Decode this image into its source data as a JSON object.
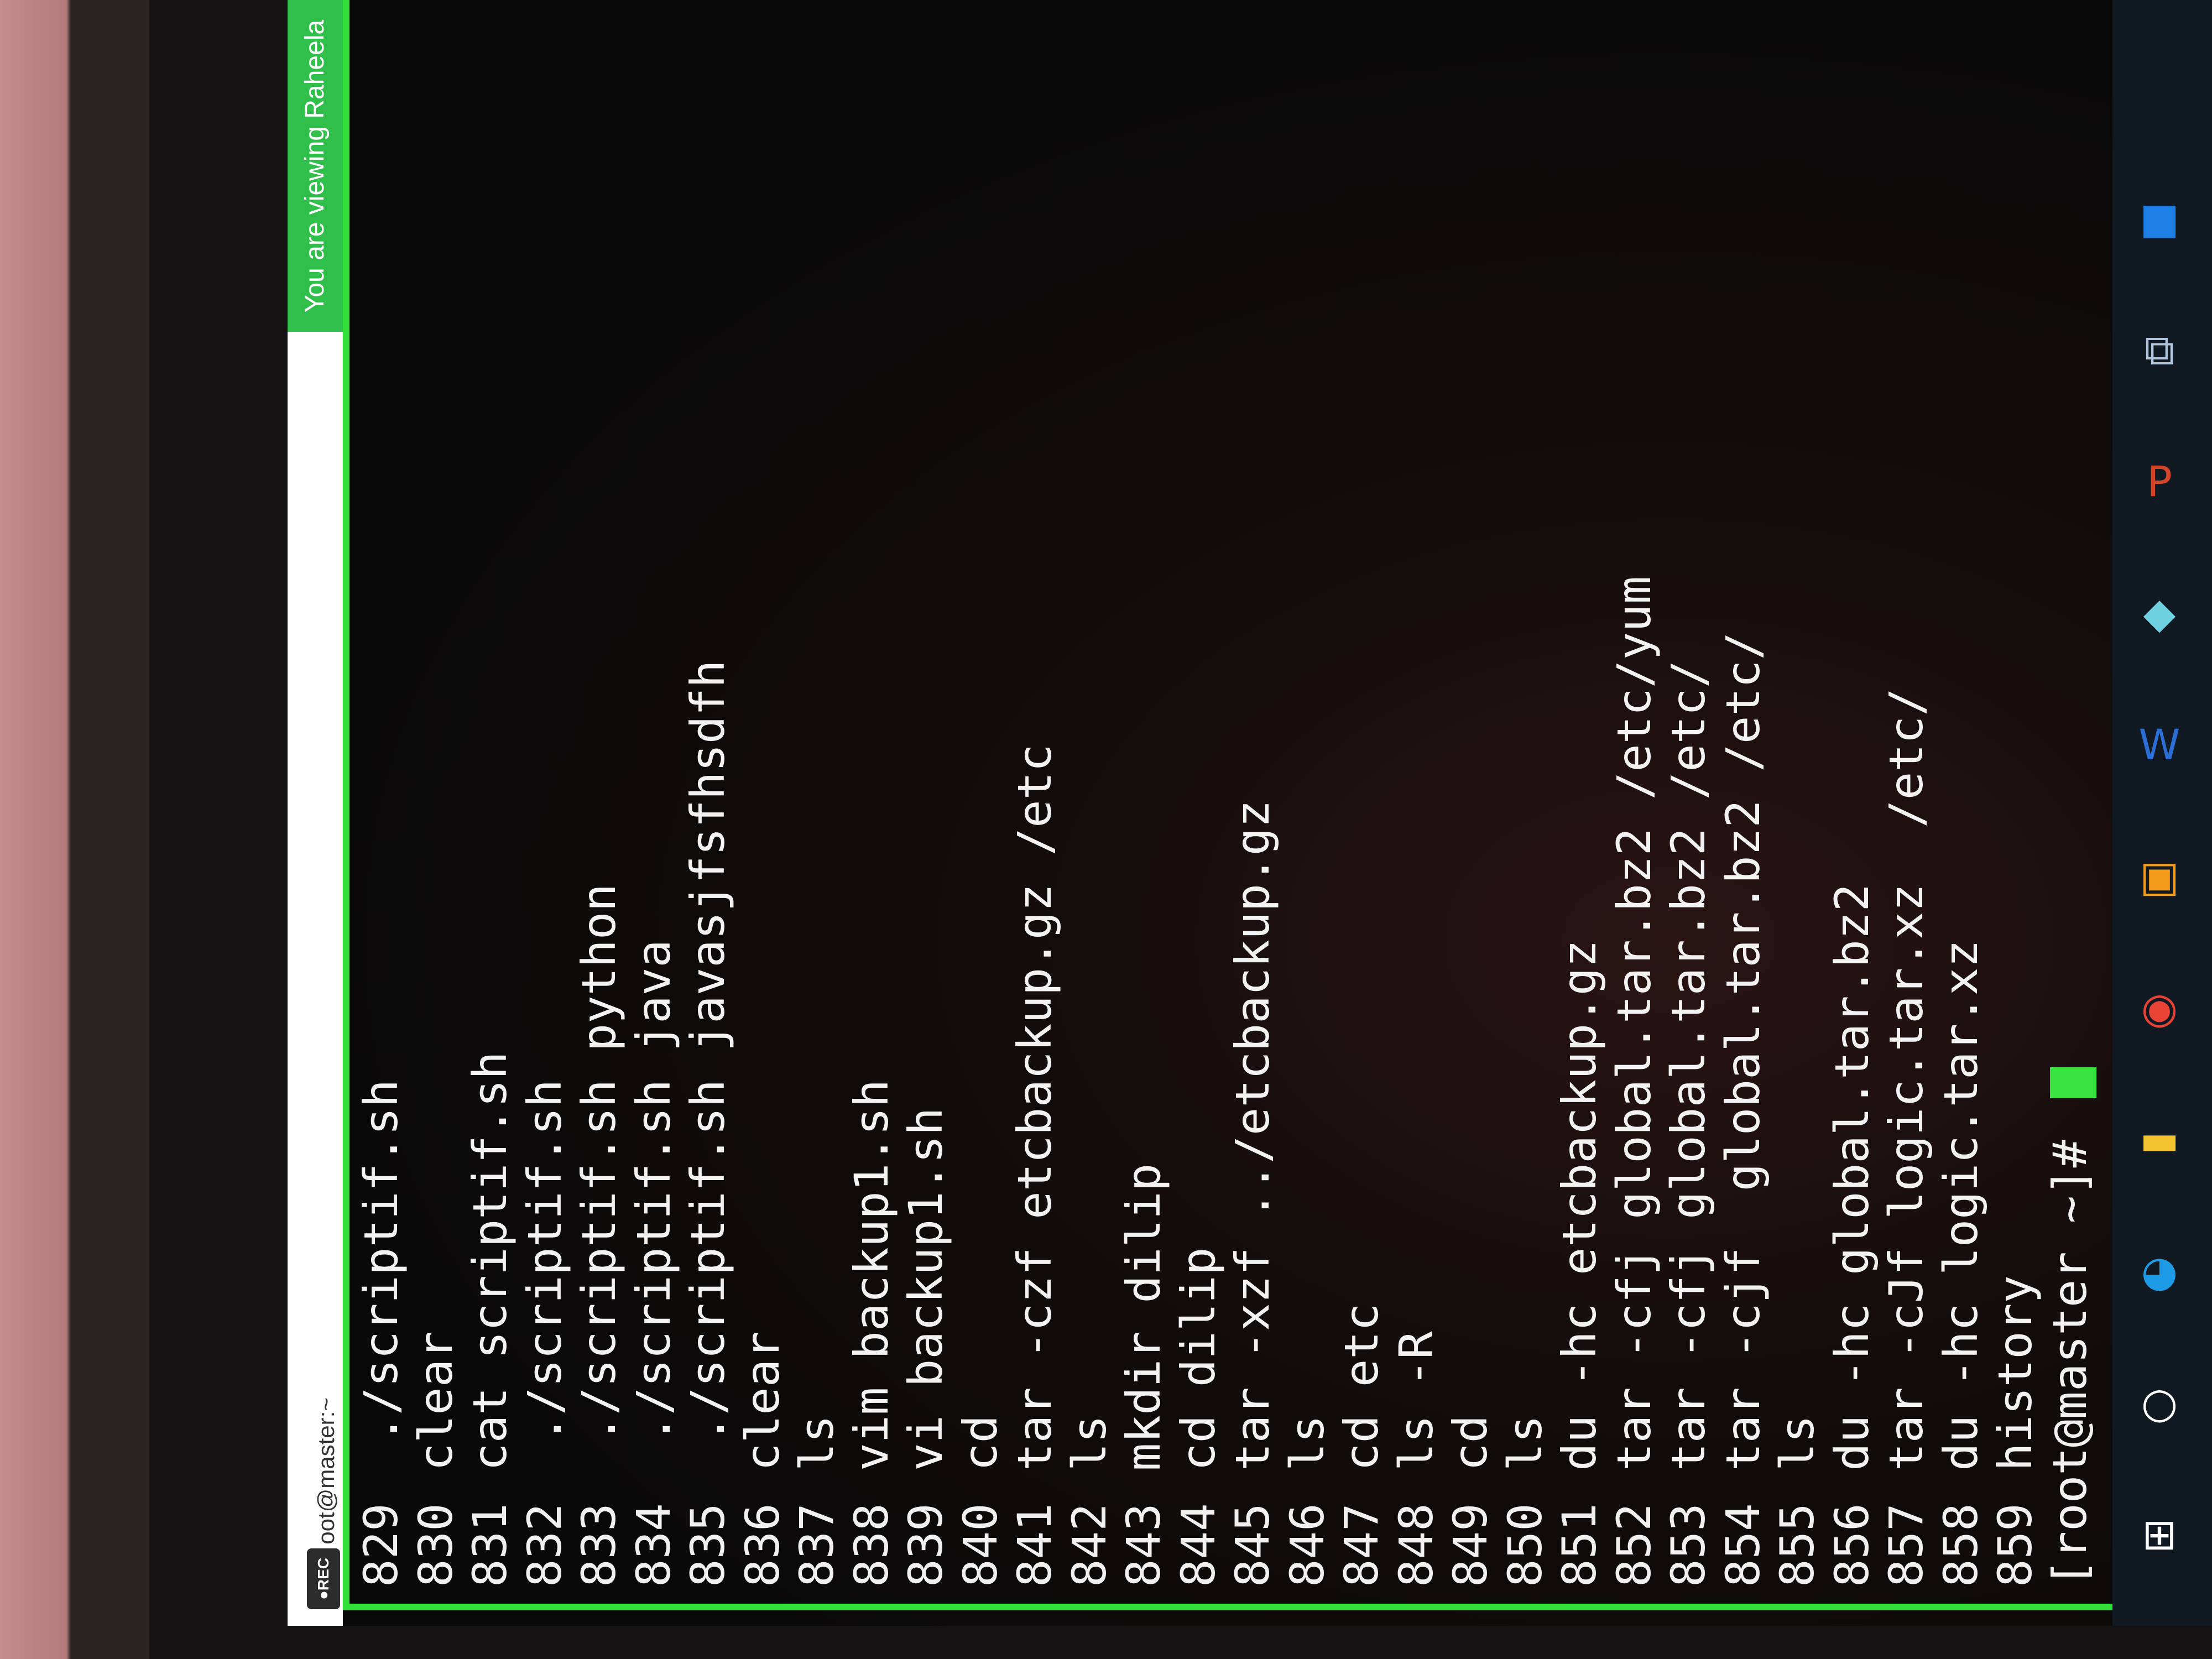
{
  "window": {
    "title": "oot@master:~",
    "recording_badge": "REC",
    "viewing_banner": "You are viewing Raheela"
  },
  "terminal": {
    "lines": [
      {
        "num": "829",
        "cmd": " ./scriptif.sh"
      },
      {
        "num": "830",
        "cmd": "clear"
      },
      {
        "num": "831",
        "cmd": "cat scriptif.sh"
      },
      {
        "num": "832",
        "cmd": " ./scriptif.sh"
      },
      {
        "num": "833",
        "cmd": " ./scriptif.sh python"
      },
      {
        "num": "834",
        "cmd": " ./scriptif.sh java"
      },
      {
        "num": "835",
        "cmd": " ./scriptif.sh javasjfsfhsdfh"
      },
      {
        "num": "836",
        "cmd": "clear"
      },
      {
        "num": "837",
        "cmd": "ls"
      },
      {
        "num": "838",
        "cmd": "vim backup1.sh"
      },
      {
        "num": "839",
        "cmd": "vi backup1.sh"
      },
      {
        "num": "840",
        "cmd": "cd"
      },
      {
        "num": "841",
        "cmd": "tar -czf etcbackup.gz /etc"
      },
      {
        "num": "842",
        "cmd": "ls"
      },
      {
        "num": "843",
        "cmd": "mkdir dilip"
      },
      {
        "num": "844",
        "cmd": "cd dilip"
      },
      {
        "num": "845",
        "cmd": "tar -xzf ../etcbackup.gz"
      },
      {
        "num": "846",
        "cmd": "ls"
      },
      {
        "num": "847",
        "cmd": "cd etc"
      },
      {
        "num": "848",
        "cmd": "ls -R"
      },
      {
        "num": "849",
        "cmd": "cd"
      },
      {
        "num": "850",
        "cmd": "ls"
      },
      {
        "num": "851",
        "cmd": "du -hc etcbackup.gz"
      },
      {
        "num": "852",
        "cmd": "tar -cfj global.tar.bz2 /etc/yum"
      },
      {
        "num": "853",
        "cmd": "tar -cfj global.tar.bz2 /etc/"
      },
      {
        "num": "854",
        "cmd": "tar -cjf  global.tar.bz2 /etc/"
      },
      {
        "num": "855",
        "cmd": "ls"
      },
      {
        "num": "856",
        "cmd": "du -hc global.tar.bz2"
      },
      {
        "num": "857",
        "cmd": "tar -cJf logic.tar.xz  /etc/"
      },
      {
        "num": "858",
        "cmd": "du -hc logic.tar.xz"
      },
      {
        "num": "859",
        "cmd": "history"
      }
    ],
    "prompt": "[root@master ~]# "
  },
  "taskbar": {
    "icons": [
      {
        "name": "start-icon",
        "glyph": "⊞",
        "color": "#ffffff"
      },
      {
        "name": "search-icon",
        "glyph": "○",
        "color": "#ffffff"
      },
      {
        "name": "edge-icon",
        "glyph": "◕",
        "color": "#1e9be6"
      },
      {
        "name": "file-explorer-icon",
        "glyph": "▬",
        "color": "#f4c430"
      },
      {
        "name": "chrome-icon",
        "glyph": "◉",
        "color": "#e84335"
      },
      {
        "name": "app-icon",
        "glyph": "▣",
        "color": "#f59b1c"
      },
      {
        "name": "word-icon",
        "glyph": "W",
        "color": "#2b6fd6"
      },
      {
        "name": "crystal-icon",
        "glyph": "◆",
        "color": "#6fd0e0"
      },
      {
        "name": "powerpoint-icon",
        "glyph": "P",
        "color": "#d4462a"
      },
      {
        "name": "network-icon",
        "glyph": "⧉",
        "color": "#b0c4de"
      },
      {
        "name": "blue-app-icon",
        "glyph": "■",
        "color": "#1e7fe6"
      }
    ]
  },
  "colors": {
    "terminal_bg": "#0a0909",
    "terminal_text": "#f2f2f2",
    "cursor": "#39e33f",
    "frame_highlight": "#33e03a",
    "banner": "#2fbf4a"
  }
}
